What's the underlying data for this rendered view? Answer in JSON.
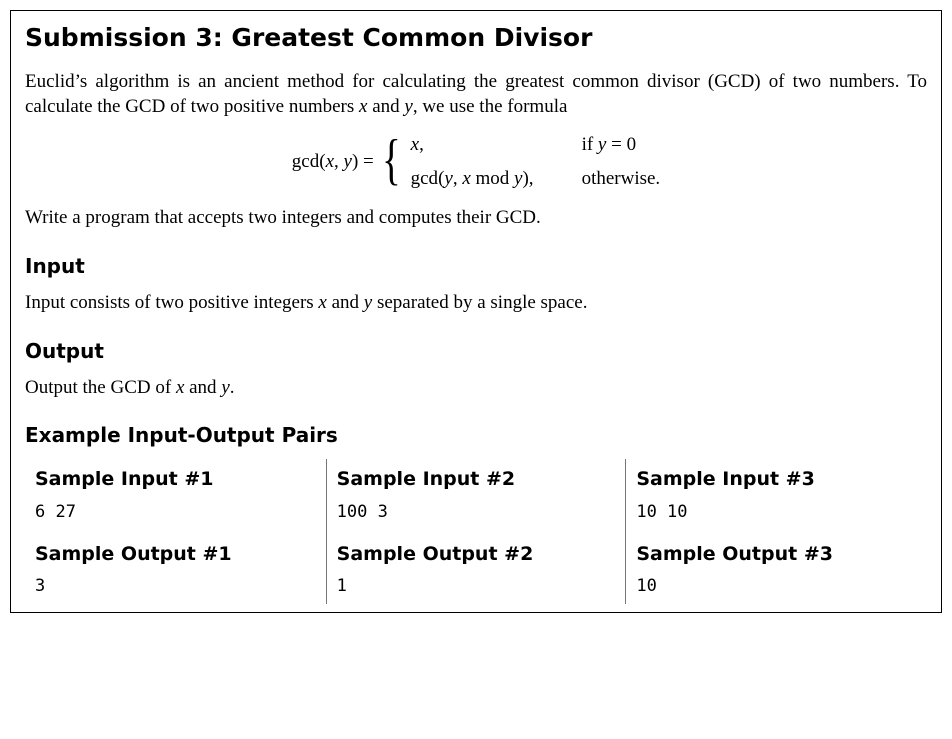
{
  "title": "Submission 3: Greatest Common Divisor",
  "intro_1": "Euclid’s algorithm is an ancient method for calculating the greatest common divisor (GCD) of two numbers. To calculate the GCD of two positive numbers ",
  "intro_2": " and ",
  "intro_3": ", we use the formula",
  "var_x": "x",
  "var_y": "y",
  "formula": {
    "lhs_gcd": "gcd",
    "lhs_paren_open": "(",
    "lhs_comma": ", ",
    "lhs_paren_close": ") = ",
    "case1_val": "x",
    "case1_comma": ",",
    "case1_cond_pre": "if ",
    "case1_cond_eq": " = 0",
    "case2_gcd": "gcd",
    "case2_open": "(",
    "case2_mid": ", ",
    "case2_mod": " mod ",
    "case2_close": "),",
    "case2_cond": "otherwise."
  },
  "task_line": "Write a program that accepts two integers and computes their GCD.",
  "input_head": "Input",
  "input_text_1": "Input consists of two positive integers ",
  "input_text_2": " and ",
  "input_text_3": " separated by a single space.",
  "output_head": "Output",
  "output_text_1": "Output the GCD of ",
  "output_text_2": " and ",
  "output_text_3": ".",
  "examples_head": "Example Input-Output Pairs",
  "samples": [
    {
      "in_label": "Sample Input #1",
      "in_val": "6 27",
      "out_label": "Sample Output #1",
      "out_val": "3"
    },
    {
      "in_label": "Sample Input #2",
      "in_val": "100 3",
      "out_label": "Sample Output #2",
      "out_val": "1"
    },
    {
      "in_label": "Sample Input #3",
      "in_val": "10 10",
      "out_label": "Sample Output #3",
      "out_val": "10"
    }
  ]
}
